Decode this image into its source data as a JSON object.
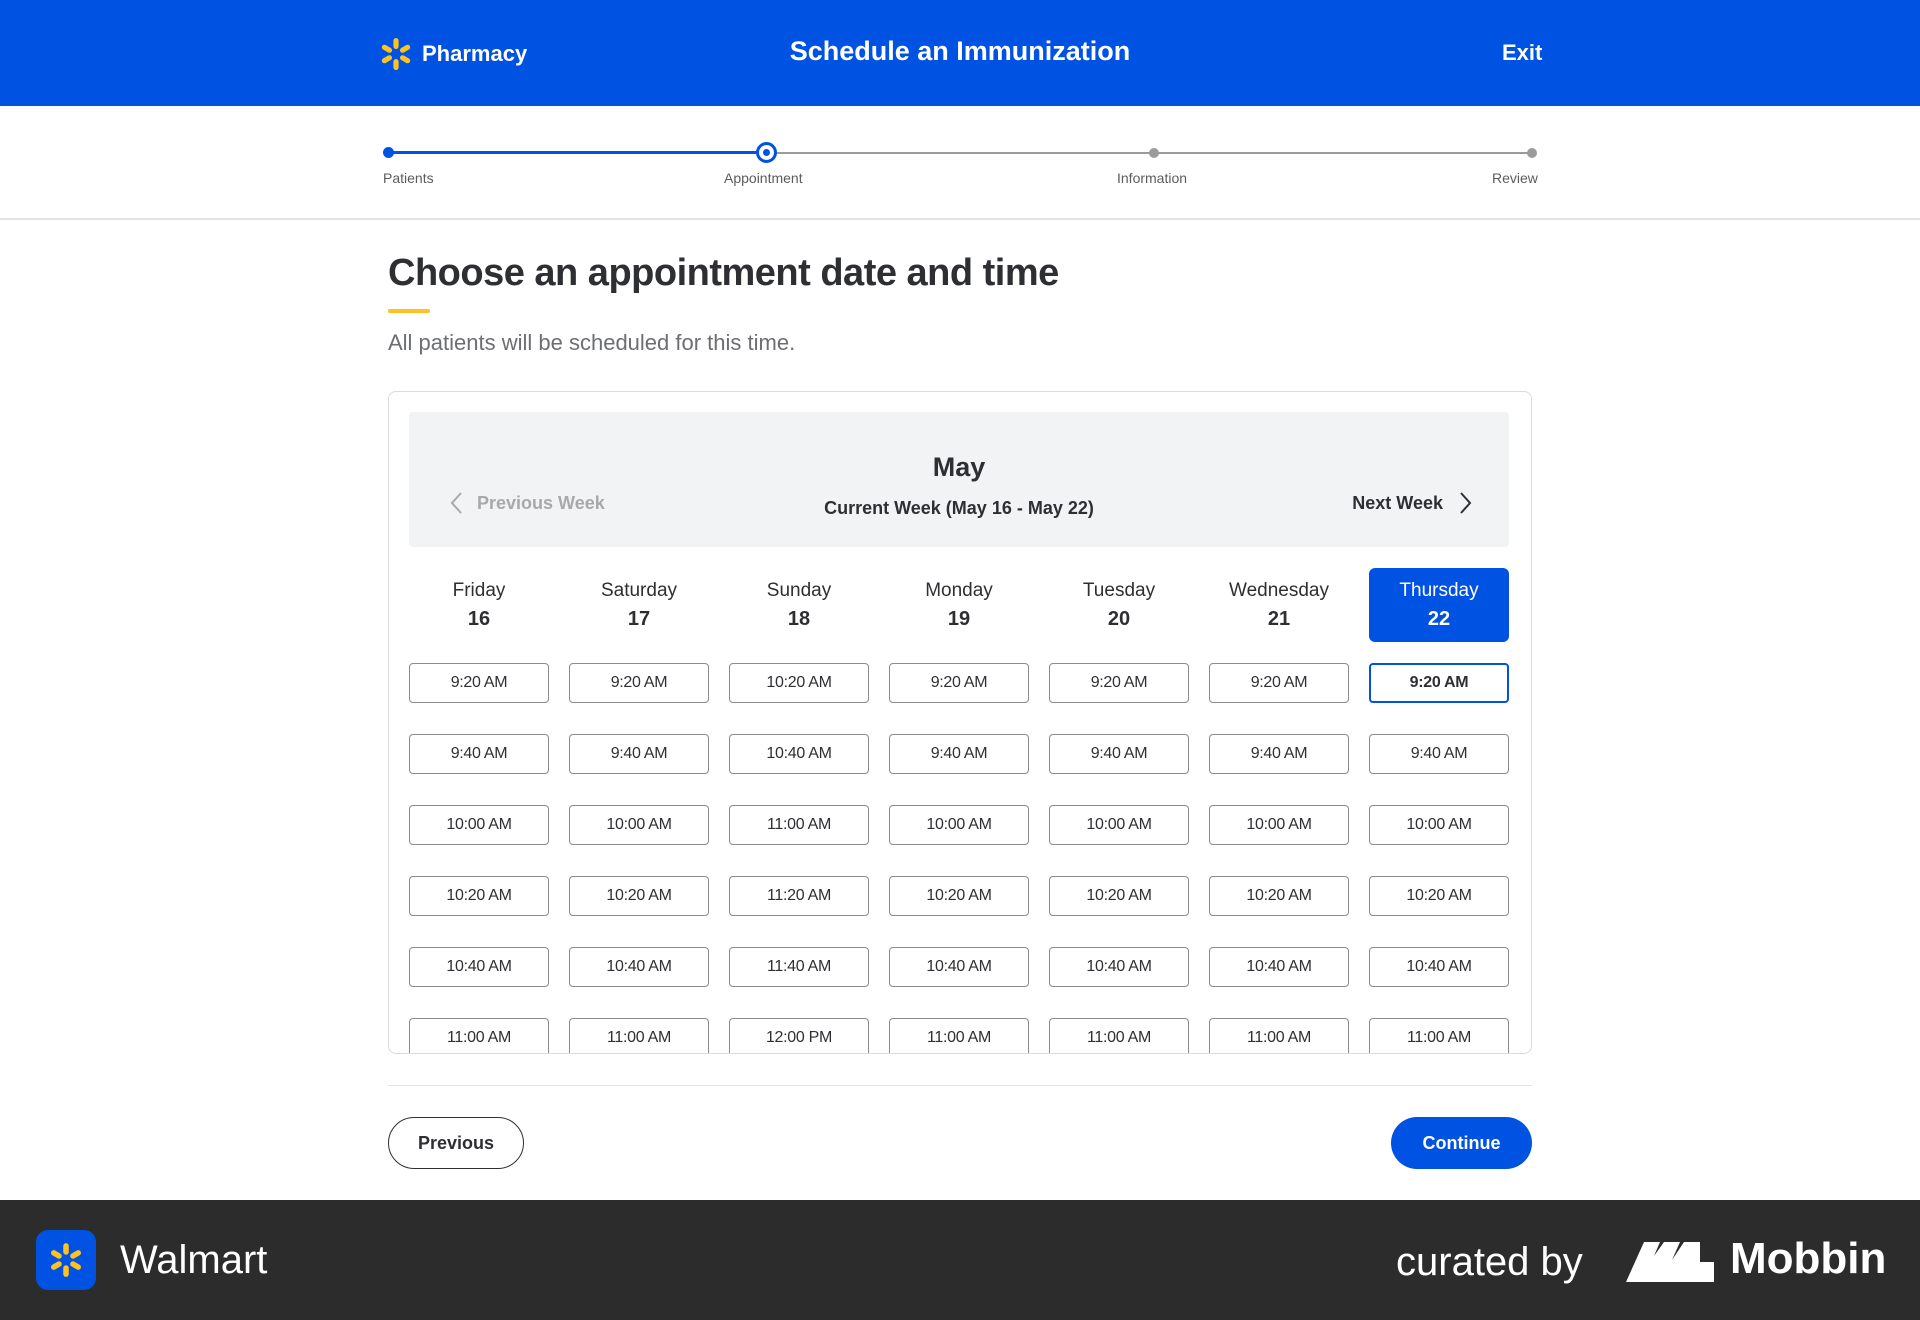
{
  "header": {
    "brand_label": "Pharmacy",
    "title": "Schedule an Immunization",
    "exit_label": "Exit"
  },
  "stepper": {
    "steps": [
      {
        "label": "Patients",
        "state": "done"
      },
      {
        "label": "Appointment",
        "state": "current"
      },
      {
        "label": "Information",
        "state": "todo"
      },
      {
        "label": "Review",
        "state": "todo"
      }
    ]
  },
  "main": {
    "heading": "Choose an appointment date and time",
    "subheading": "All patients will be scheduled for this time."
  },
  "calendar": {
    "month": "May",
    "previous_week_label": "Previous Week",
    "current_week_label": "Current Week (May 16 - May 22)",
    "next_week_label": "Next Week",
    "days": [
      {
        "name": "Friday",
        "number": "16",
        "selected": false,
        "slots": [
          "9:20 AM",
          "9:40 AM",
          "10:00 AM",
          "10:20 AM",
          "10:40 AM",
          "11:00 AM"
        ]
      },
      {
        "name": "Saturday",
        "number": "17",
        "selected": false,
        "slots": [
          "9:20 AM",
          "9:40 AM",
          "10:00 AM",
          "10:20 AM",
          "10:40 AM",
          "11:00 AM"
        ]
      },
      {
        "name": "Sunday",
        "number": "18",
        "selected": false,
        "slots": [
          "10:20 AM",
          "10:40 AM",
          "11:00 AM",
          "11:20 AM",
          "11:40 AM",
          "12:00 PM"
        ]
      },
      {
        "name": "Monday",
        "number": "19",
        "selected": false,
        "slots": [
          "9:20 AM",
          "9:40 AM",
          "10:00 AM",
          "10:20 AM",
          "10:40 AM",
          "11:00 AM"
        ]
      },
      {
        "name": "Tuesday",
        "number": "20",
        "selected": false,
        "slots": [
          "9:20 AM",
          "9:40 AM",
          "10:00 AM",
          "10:20 AM",
          "10:40 AM",
          "11:00 AM"
        ]
      },
      {
        "name": "Wednesday",
        "number": "21",
        "selected": false,
        "slots": [
          "9:20 AM",
          "9:40 AM",
          "10:00 AM",
          "10:20 AM",
          "10:40 AM",
          "11:00 AM"
        ]
      },
      {
        "name": "Thursday",
        "number": "22",
        "selected": true,
        "selected_slot": "9:20 AM",
        "slots": [
          "9:20 AM",
          "9:40 AM",
          "10:00 AM",
          "10:20 AM",
          "10:40 AM",
          "11:00 AM"
        ]
      }
    ]
  },
  "actions": {
    "previous_label": "Previous",
    "continue_label": "Continue"
  },
  "footer": {
    "app_name": "Walmart",
    "curated_by": "curated by",
    "curator": "Mobbin"
  },
  "colors": {
    "brand_blue": "#0053e2",
    "spark_yellow": "#ffc220",
    "footer_bg": "#2c2c2c"
  },
  "icons": [
    "walmart-spark-icon",
    "chevron-left-icon",
    "chevron-right-icon",
    "mobbin-logo-icon"
  ]
}
